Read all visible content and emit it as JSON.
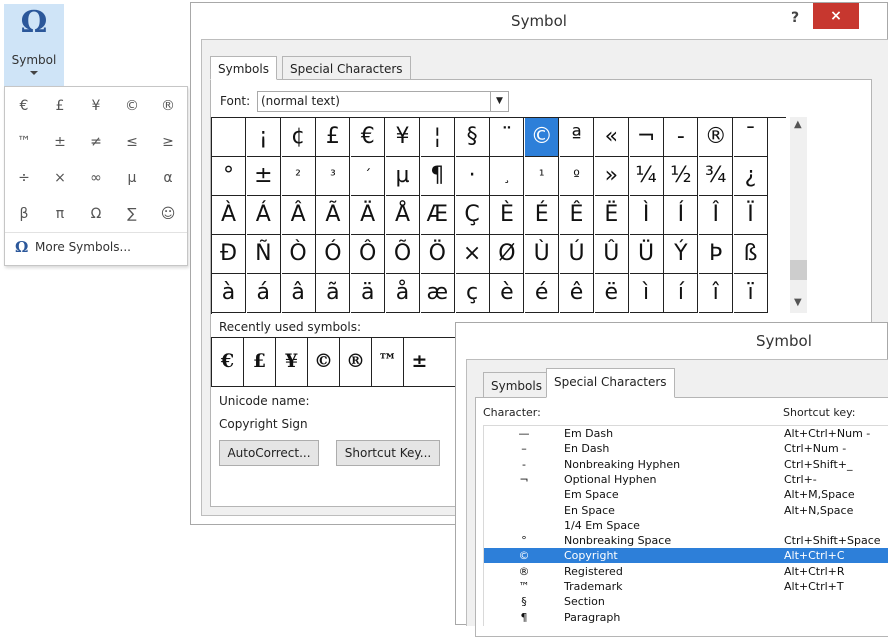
{
  "ribbon": {
    "icon": "Ω",
    "label": "Symbol"
  },
  "dropdown": {
    "symbols": [
      "€",
      "£",
      "¥",
      "©",
      "®",
      "™",
      "±",
      "≠",
      "≤",
      "≥",
      "÷",
      "×",
      "∞",
      "µ",
      "α",
      "β",
      "π",
      "Ω",
      "∑",
      "☺"
    ],
    "more_icon": "Ω",
    "more_label": "More Symbols..."
  },
  "dialog1": {
    "title": "Symbol",
    "help": "?",
    "close": "×",
    "tab_symbols": "Symbols",
    "tab_special": "Special Characters",
    "font_label": "Font:",
    "font_value": "(normal text)",
    "grid": [
      [
        "",
        "¡",
        "¢",
        "£",
        "€",
        "¥",
        "¦",
        "§",
        "¨",
        "©",
        "ª",
        "«",
        "¬",
        "-",
        "®",
        "¯"
      ],
      [
        "°",
        "±",
        "²",
        "³",
        "´",
        "µ",
        "¶",
        "·",
        "¸",
        "¹",
        "º",
        "»",
        "¼",
        "½",
        "¾",
        "¿"
      ],
      [
        "À",
        "Á",
        "Â",
        "Ã",
        "Ä",
        "Å",
        "Æ",
        "Ç",
        "È",
        "É",
        "Ê",
        "Ë",
        "Ì",
        "Í",
        "Î",
        "Ï"
      ],
      [
        "Ð",
        "Ñ",
        "Ò",
        "Ó",
        "Ô",
        "Õ",
        "Ö",
        "×",
        "Ø",
        "Ù",
        "Ú",
        "Û",
        "Ü",
        "Ý",
        "Þ",
        "ß"
      ],
      [
        "à",
        "á",
        "â",
        "ã",
        "ä",
        "å",
        "æ",
        "ç",
        "è",
        "é",
        "ê",
        "ë",
        "ì",
        "í",
        "î",
        "ï"
      ]
    ],
    "recent_label": "Recently used symbols:",
    "recent": [
      "€",
      "£",
      "¥",
      "©",
      "®",
      "™",
      "±"
    ],
    "unicode_label": "Unicode name:",
    "unicode_value": "Copyright Sign",
    "autocorrect_btn": "AutoCorrect...",
    "shortcut_btn": "Shortcut Key..."
  },
  "dialog2": {
    "title": "Symbol",
    "tab_symbols": "Symbols",
    "tab_special": "Special Characters",
    "col_character": "Character:",
    "col_shortcut": "Shortcut key:",
    "rows": [
      {
        "glyph": "—",
        "name": "Em Dash",
        "key": "Alt+Ctrl+Num -"
      },
      {
        "glyph": "–",
        "name": "En Dash",
        "key": "Ctrl+Num -"
      },
      {
        "glyph": "-",
        "name": "Nonbreaking Hyphen",
        "key": "Ctrl+Shift+_"
      },
      {
        "glyph": "¬",
        "name": "Optional Hyphen",
        "key": "Ctrl+-"
      },
      {
        "glyph": "",
        "name": "Em Space",
        "key": "Alt+M,Space"
      },
      {
        "glyph": "",
        "name": "En Space",
        "key": "Alt+N,Space"
      },
      {
        "glyph": "",
        "name": "1/4 Em Space",
        "key": ""
      },
      {
        "glyph": "°",
        "name": "Nonbreaking Space",
        "key": "Ctrl+Shift+Space"
      },
      {
        "glyph": "©",
        "name": "Copyright",
        "key": "Alt+Ctrl+C"
      },
      {
        "glyph": "®",
        "name": "Registered",
        "key": "Alt+Ctrl+R"
      },
      {
        "glyph": "™",
        "name": "Trademark",
        "key": "Alt+Ctrl+T"
      },
      {
        "glyph": "§",
        "name": "Section",
        "key": ""
      },
      {
        "glyph": "¶",
        "name": "Paragraph",
        "key": ""
      }
    ],
    "selected_row": 8
  },
  "colors": {
    "accent": "#2d7fd9",
    "close": "#c7372f",
    "ribbon_highlight": "#cfe4f7"
  }
}
